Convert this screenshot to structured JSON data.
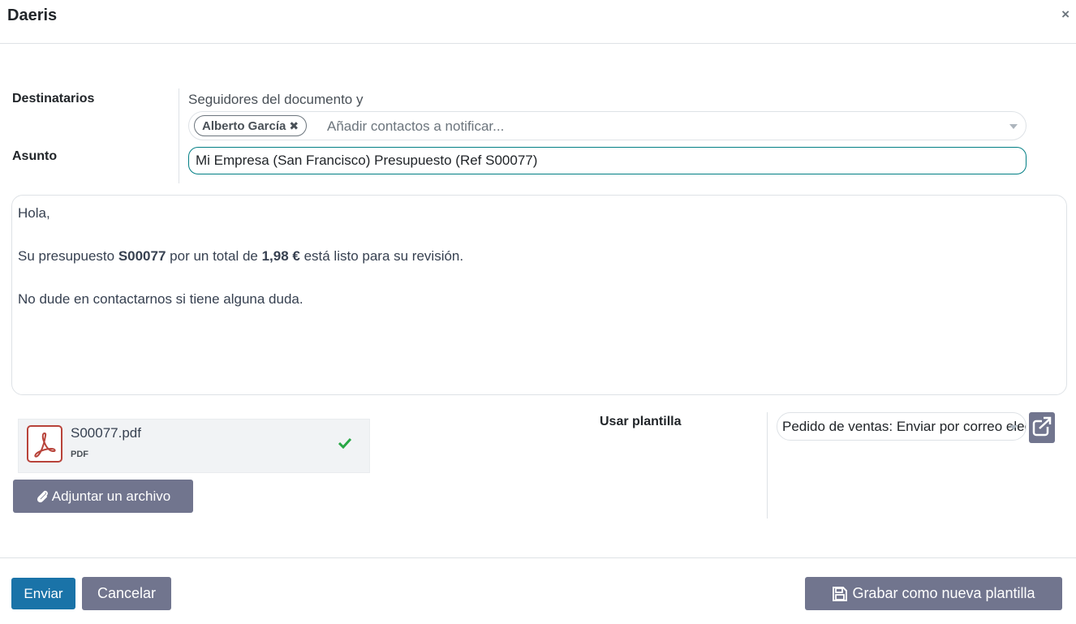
{
  "dialog": {
    "title": "Daeris",
    "close_label": "×"
  },
  "form": {
    "recipients_label": "Destinatarios",
    "followers_text": "Seguidores del documento y",
    "recipients": [
      {
        "name": "Alberto García"
      }
    ],
    "recipients_placeholder": "Añadir contactos a notificar...",
    "subject_label": "Asunto",
    "subject_value": "Mi Empresa (San Francisco) Presupuesto (Ref S00077)"
  },
  "body": {
    "greeting": "Hola,",
    "line1_pre": "Su presupuesto ",
    "order_ref": "S00077",
    "line1_mid": " por un total de ",
    "amount": "1,98 €",
    "line1_post": " está listo para su revisión.",
    "line2": "No dude en contactarnos si tiene alguna duda."
  },
  "attachment": {
    "filename": "S00077.pdf",
    "type": "PDF",
    "icon": "pdf-file-icon",
    "status_icon": "check-icon",
    "add_label": "Adjuntar un archivo",
    "add_icon": "paperclip-icon"
  },
  "template": {
    "label": "Usar plantilla",
    "selected": "Pedido de ventas: Enviar por correo electrónico",
    "external_icon": "external-link-icon"
  },
  "footer": {
    "send_label": "Enviar",
    "cancel_label": "Cancelar",
    "save_template_label": "Grabar como nueva plantilla",
    "save_icon": "floppy-disk-icon"
  },
  "colors": {
    "primary": "#1a73a8",
    "secondary": "#71758e",
    "focus_border": "#017e84",
    "success": "#28a745",
    "pdf_red": "#b8433a"
  }
}
